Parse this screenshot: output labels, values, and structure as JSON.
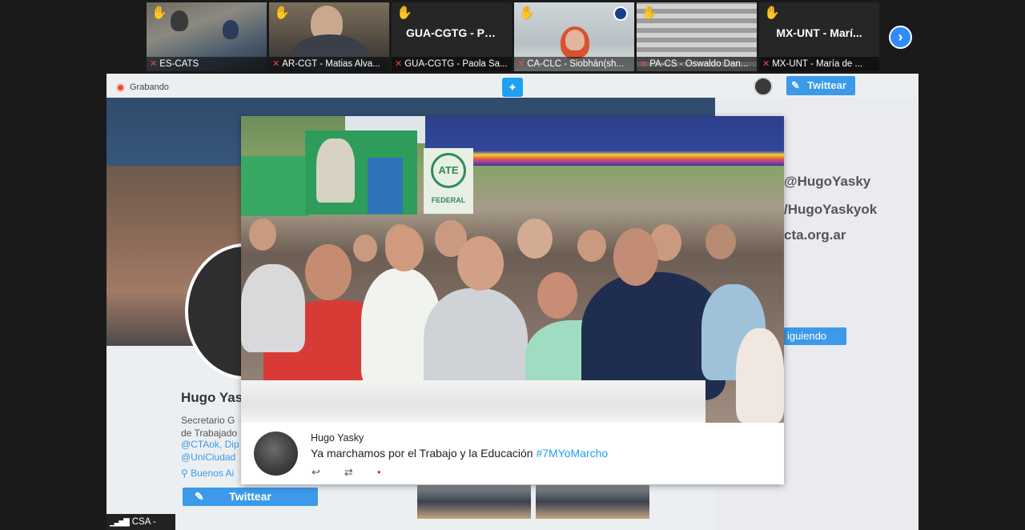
{
  "participants": [
    {
      "tile_title": "",
      "footer": "ES-CATS"
    },
    {
      "tile_title": "",
      "footer": "AR-CGT - Matias Alva..."
    },
    {
      "tile_title": "GUA-CGTG - Pa...",
      "footer": "GUA-CGTG - Paola Sa..."
    },
    {
      "tile_title": "",
      "footer": "CA-CLC - Siobhán(sh..."
    },
    {
      "tile_title": "",
      "footer": "PA-CS - Oswaldo Dan..."
    },
    {
      "tile_title": "MX-UNT - Marí...",
      "footer": "MX-UNT - María de ..."
    }
  ],
  "share": {
    "recording_label": "Grabando",
    "twittear_label": "Twittear",
    "profile": {
      "name": "Hugo Yas",
      "bio_line1": "Secretario G",
      "bio_line2": "de Trabajado",
      "link1": "@CTAok, Dip",
      "link2": "@UniCiudad",
      "location": "Buenos Ai"
    },
    "right_info": {
      "handle": "@HugoYasky",
      "fb": "/HugoYaskyok",
      "web": "cta.org.ar",
      "following_label": "iguiendo"
    }
  },
  "photo": {
    "ate_text": "ATE",
    "federal_text": "FEDERAL"
  },
  "tweet": {
    "author": "Hugo Yasky",
    "text": "Ya marchamos por el Trabajo y la Educación",
    "hashtag": "#7MYoMarcho"
  },
  "status": {
    "signal_label": "CSA - VIVO"
  },
  "colors": {
    "twitter_blue": "#1da1f2",
    "button_blue": "#3c9ae8",
    "zoom_blue": "#2d8cff",
    "mute_red": "#e5484d",
    "hand_yellow": "#f5c518"
  }
}
